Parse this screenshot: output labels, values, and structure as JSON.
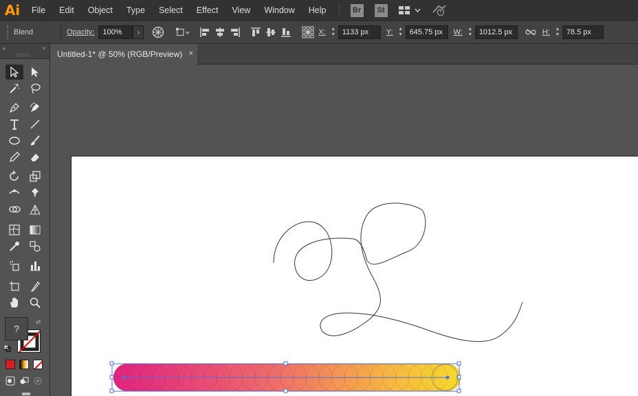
{
  "app": {
    "logo": "Ai"
  },
  "menu": [
    "File",
    "Edit",
    "Object",
    "Type",
    "Select",
    "Effect",
    "View",
    "Window",
    "Help"
  ],
  "app_badges": {
    "bridge": "Br",
    "stock": "St"
  },
  "control": {
    "selection_type": "Blend",
    "opacity_label": "Opacity:",
    "opacity_value": "100%",
    "x_label": "X:",
    "x_value": "1133 px",
    "y_label": "Y:",
    "y_value": "645.75 px",
    "w_label": "W:",
    "w_value": "1012.5 px",
    "h_label": "H:",
    "h_value": "78.5 px"
  },
  "document": {
    "tab_title": "Untitled-1* @ 50% (RGB/Preview)",
    "close_glyph": "×"
  },
  "toolbar": {
    "fill_stroke_placeholder": "?"
  },
  "colors": {
    "menubar": "#323232",
    "controlbar": "#424242",
    "pasteboard": "#535353",
    "artboard": "#ffffff",
    "blend_start": "#e0237f",
    "blend_end": "#f6d92a",
    "selection": "#4a6fe3",
    "accent_logo": "#ff9a00"
  },
  "icons": {
    "workspace": "workspace-switcher-icon",
    "gpu": "gpu-performance-icon",
    "recolor": "recolor-artwork-icon",
    "transform": "transform-icon",
    "align": "align-icons",
    "constrain": "constrain-proportions-icon"
  }
}
